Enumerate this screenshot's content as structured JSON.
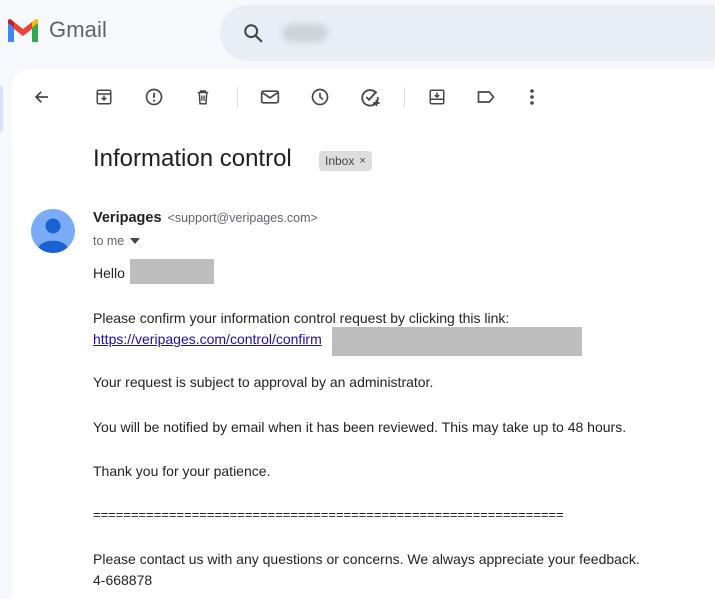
{
  "app": {
    "name": "Gmail",
    "colors": {
      "background": "#f6f8fc",
      "search_bg": "#e9eef6",
      "link": "#1a0dab",
      "avatar": "#7baaf7"
    }
  },
  "toolbar": {
    "icons": [
      "back-arrow-icon",
      "archive-icon",
      "report-spam-icon",
      "delete-icon",
      "mark-unread-icon",
      "snooze-icon",
      "add-task-icon",
      "move-to-icon",
      "label-icon",
      "more-options-icon"
    ]
  },
  "email": {
    "subject": "Information control",
    "label": "Inbox",
    "label_close": "×",
    "sender_name": "Veripages",
    "sender_email": "<support@veripages.com>",
    "to": "to me",
    "greeting": "Hello",
    "line1": "Please confirm your information control request by clicking this link:",
    "link": "https://veripages.com/control/confirm",
    "line2": "Your request is subject to approval by an administrator.",
    "line3": "You will be notified by email when it has been reviewed. This may take up to 48 hours.",
    "line4": "Thank you for your patience.",
    "divider": "==============================================================",
    "line5": "Please contact us with any questions or concerns. We always appreciate your feedback.",
    "ref": "4-668878"
  }
}
